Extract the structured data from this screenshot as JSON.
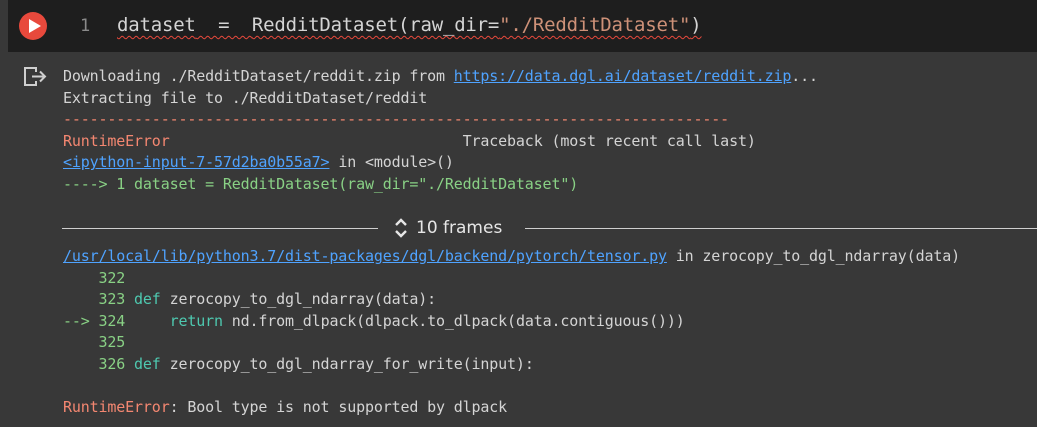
{
  "input_cell": {
    "line_number": "1",
    "code_var": "dataset",
    "code_eq": "  =  ",
    "code_call": "RedditDataset(raw_dir=",
    "code_str": "\"./RedditDataset\"",
    "code_end": ")"
  },
  "output": {
    "download_prefix": "Downloading ./RedditDataset/reddit.zip from ",
    "download_url": "https://data.dgl.ai/dataset/reddit.zip",
    "download_suffix": "...",
    "extract_line": "Extracting file to ./RedditDataset/reddit",
    "divider": "---------------------------------------------------------------------------",
    "error_name": "RuntimeError",
    "traceback_header": "                                 Traceback (most recent call last)",
    "input_link": "<ipython-input-7-57d2ba0b55a7>",
    "in_module": " in <module>()",
    "arrow_line": "----> 1 dataset = RedditDataset(raw_dir=\"./RedditDataset\")"
  },
  "frames": {
    "label": "10 frames"
  },
  "trace": {
    "file_link": "/usr/local/lib/python3.7/dist-packages/dgl/backend/pytorch/tensor.py",
    "file_suffix": " in zerocopy_to_dgl_ndarray(data)",
    "lines": [
      {
        "prefix": "    322",
        "code": ""
      },
      {
        "prefix": "    323 ",
        "kw": "def",
        "code": " zerocopy_to_dgl_ndarray(data):"
      },
      {
        "prefix": "--> 324     ",
        "kw": "return",
        "code": " nd.from_dlpack(dlpack.to_dlpack(data.contiguous()))"
      },
      {
        "prefix": "    325",
        "code": ""
      },
      {
        "prefix": "    326 ",
        "kw": "def",
        "code": " zerocopy_to_dgl_ndarray_for_write(input):"
      }
    ],
    "final_error_name": "RuntimeError",
    "final_error_msg": ": Bool type is not supported by dlpack"
  }
}
